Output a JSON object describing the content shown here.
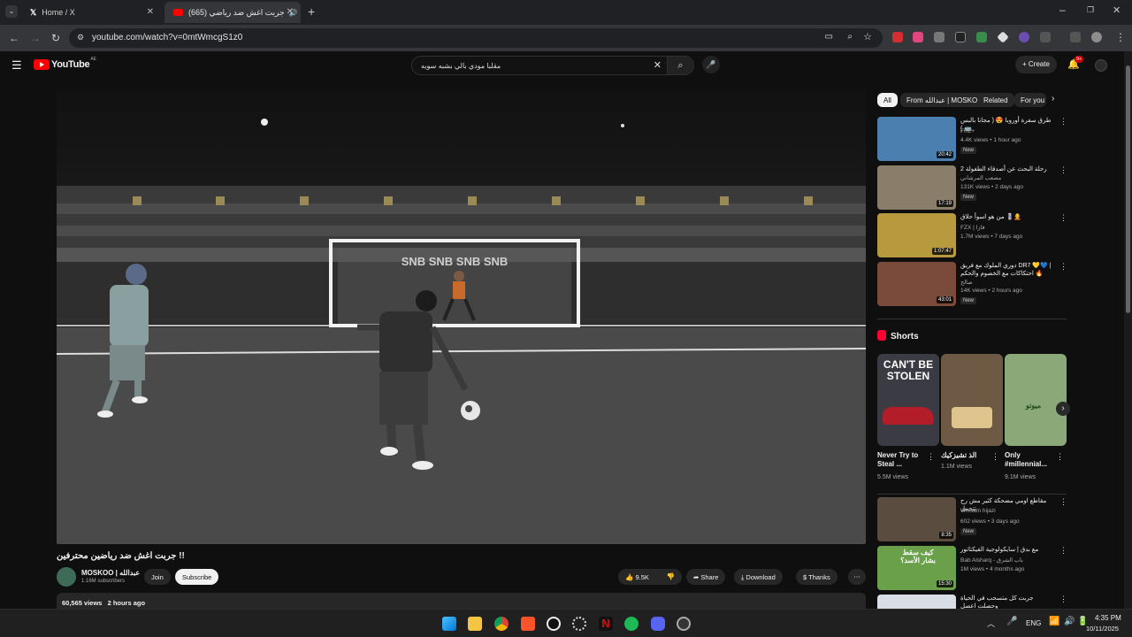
{
  "browser": {
    "tabs": [
      {
        "title": "Home / X",
        "icon": "x-logo-icon"
      },
      {
        "title": "(665) جربت اغش ضد رياضي",
        "icon": "youtube-icon",
        "audio": true
      }
    ],
    "url": "youtube.com/watch?v=0mtWmcgS1z0"
  },
  "youtube": {
    "logo": "YouTube",
    "region": "AE",
    "search_value": "مقلبا مودي بالي بشبه سوبه",
    "create_label": "Create",
    "notifications_count": "9+",
    "chips": [
      "All",
      "From عبدالله | MOSKOO",
      "Related",
      "For you"
    ],
    "video": {
      "title": "جربت اغش ضد رياضين محترفين !!",
      "channel": "MOSKOO | عبدالله",
      "subscribers": "1.16M subscribers",
      "join_label": "Join",
      "subscribe_label": "Subscribe",
      "likes": "9.5K",
      "share_label": "Share",
      "download_label": "Download",
      "thanks_label": "Thanks",
      "views": "60,565 views",
      "posted": "2 hours ago",
      "goal_text": "SNB SNB SNB SNB"
    },
    "recommendations": [
      {
        "title": "طرق سفرة أوروبا 😍 ( مجانا بالبس 🚌 )",
        "channel": "FRL+",
        "meta": "4.4K views • 1 hour ago",
        "badge": "New",
        "duration": "20:42",
        "color": "#4a7fb0"
      },
      {
        "title": "رحلة البحث عن أصدقاء الطفولة 2",
        "channel": "مصعب المرشاني",
        "meta": "131K views • 2 days ago",
        "badge": "New",
        "duration": "17:19",
        "color": "#8a7d6a"
      },
      {
        "title": "من هو اسوأ حلاق 💈🧑‍🦲",
        "channel": "FZX | فازا",
        "meta": "1.7M views • 7 days ago",
        "badge": "",
        "duration": "1:07:47",
        "color": "#b89a3e"
      },
      {
        "title": "دوري الملوك مع فريق DR7 💛💙 | احتكاكات مع الخصوم والحكم 🔥",
        "channel": "صالح",
        "meta": "14K views • 2 hours ago",
        "badge": "New",
        "duration": "43:01",
        "color": "#7a4a3a"
      }
    ],
    "shorts_heading": "Shorts",
    "shorts": [
      {
        "title": "Never Try to Steal ...",
        "views": "5.5M views",
        "overlay": "CAN'T BE STOLEN",
        "color": "#3b3b44"
      },
      {
        "title": "الذ تشيزكيك",
        "views": "1.1M views",
        "overlay": "",
        "color": "#6e5a44"
      },
      {
        "title": "Only #millennial...",
        "views": "9.1M views",
        "overlay": "ميوتو",
        "color": "#8aa878"
      }
    ],
    "recommendations2": [
      {
        "title": "مقاطع اومي مضحكة كثير مش رح تتحمل",
        "channel": "Wissam hijazi",
        "meta": "602 views • 3 days ago",
        "badge": "New",
        "duration": "8:35",
        "color": "#5a4c3e"
      },
      {
        "title": "مع بدق | سايكولوجية الفيكتاتور",
        "channel": "Bab Alsharq - باب الشرق",
        "meta": "1M views • 4 months ago",
        "badge": "",
        "duration": "15:30",
        "color": "#6aa04a",
        "overlay": "كيف سقط بشار الأسد؟"
      },
      {
        "title": "جربت كل متسحب في الحياة وحصلت اعصل",
        "channel": "",
        "meta": "",
        "badge": "",
        "duration": "",
        "color": "#d9dde6"
      }
    ]
  },
  "taskbar": {
    "language": "ENG",
    "time": "4:35 PM",
    "date": "10/11/2025"
  }
}
